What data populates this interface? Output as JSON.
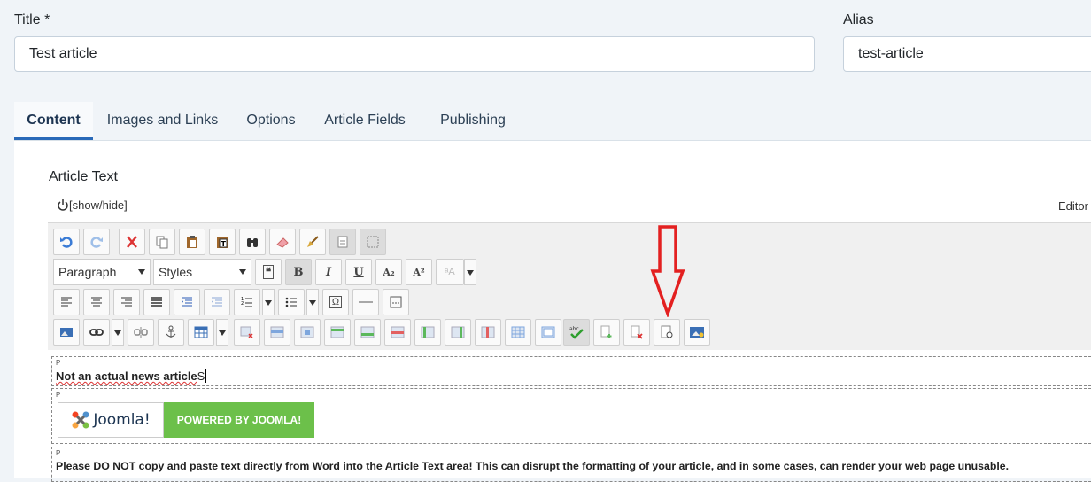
{
  "title_field": {
    "label": "Title *",
    "value": "Test article"
  },
  "alias_field": {
    "label": "Alias",
    "value": "test-article"
  },
  "tabs": [
    {
      "label": "Content"
    },
    {
      "label": "Images and Links"
    },
    {
      "label": "Options"
    },
    {
      "label": "Article Fields"
    },
    {
      "label": "Publishing"
    }
  ],
  "editor": {
    "label": "Article Text",
    "toggle_label": "[show/hide]",
    "editor_label": "Editor",
    "format_select": "Paragraph",
    "styles_select": "Styles",
    "block_tag": "P",
    "content_line1": "Not an actual news article",
    "content_line1_cursor": "S",
    "joomla_logo_text": "Joomla!",
    "joomla_badge_text": "POWERED BY JOOMLA!",
    "content_line3": "Please DO NOT copy and paste text directly from Word into the Article Text area! This can disrupt the formatting of your article, and in some cases, can render your web page unusable."
  },
  "colors": {
    "tab_active_border": "#2a69b8",
    "joomla_green": "#6cc04a",
    "arrow_red": "#e32020"
  }
}
